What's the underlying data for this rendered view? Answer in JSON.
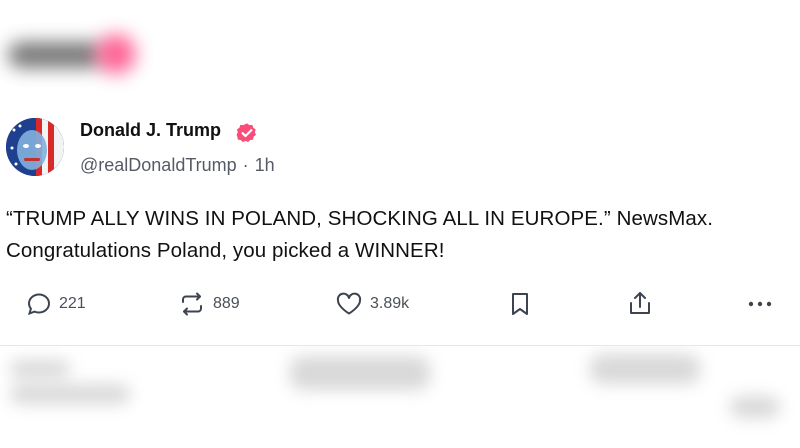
{
  "post": {
    "author_name": "Donald J. Trump",
    "handle": "@realDonaldTrump",
    "separator": "·",
    "time": "1h",
    "text_line1": "“TRUMP ALLY WINS IN POLAND, SHOCKING ALL IN EUROPE.” NewsMax.",
    "text_line2": "Congratulations Poland, you picked a WINNER!",
    "verified_color": "#fa4d7a"
  },
  "actions": {
    "replies": "221",
    "reposts": "889",
    "likes": "3.89k",
    "icons": [
      "reply-icon",
      "repost-icon",
      "like-icon",
      "bookmark-icon",
      "share-icon",
      "more-icon"
    ]
  }
}
